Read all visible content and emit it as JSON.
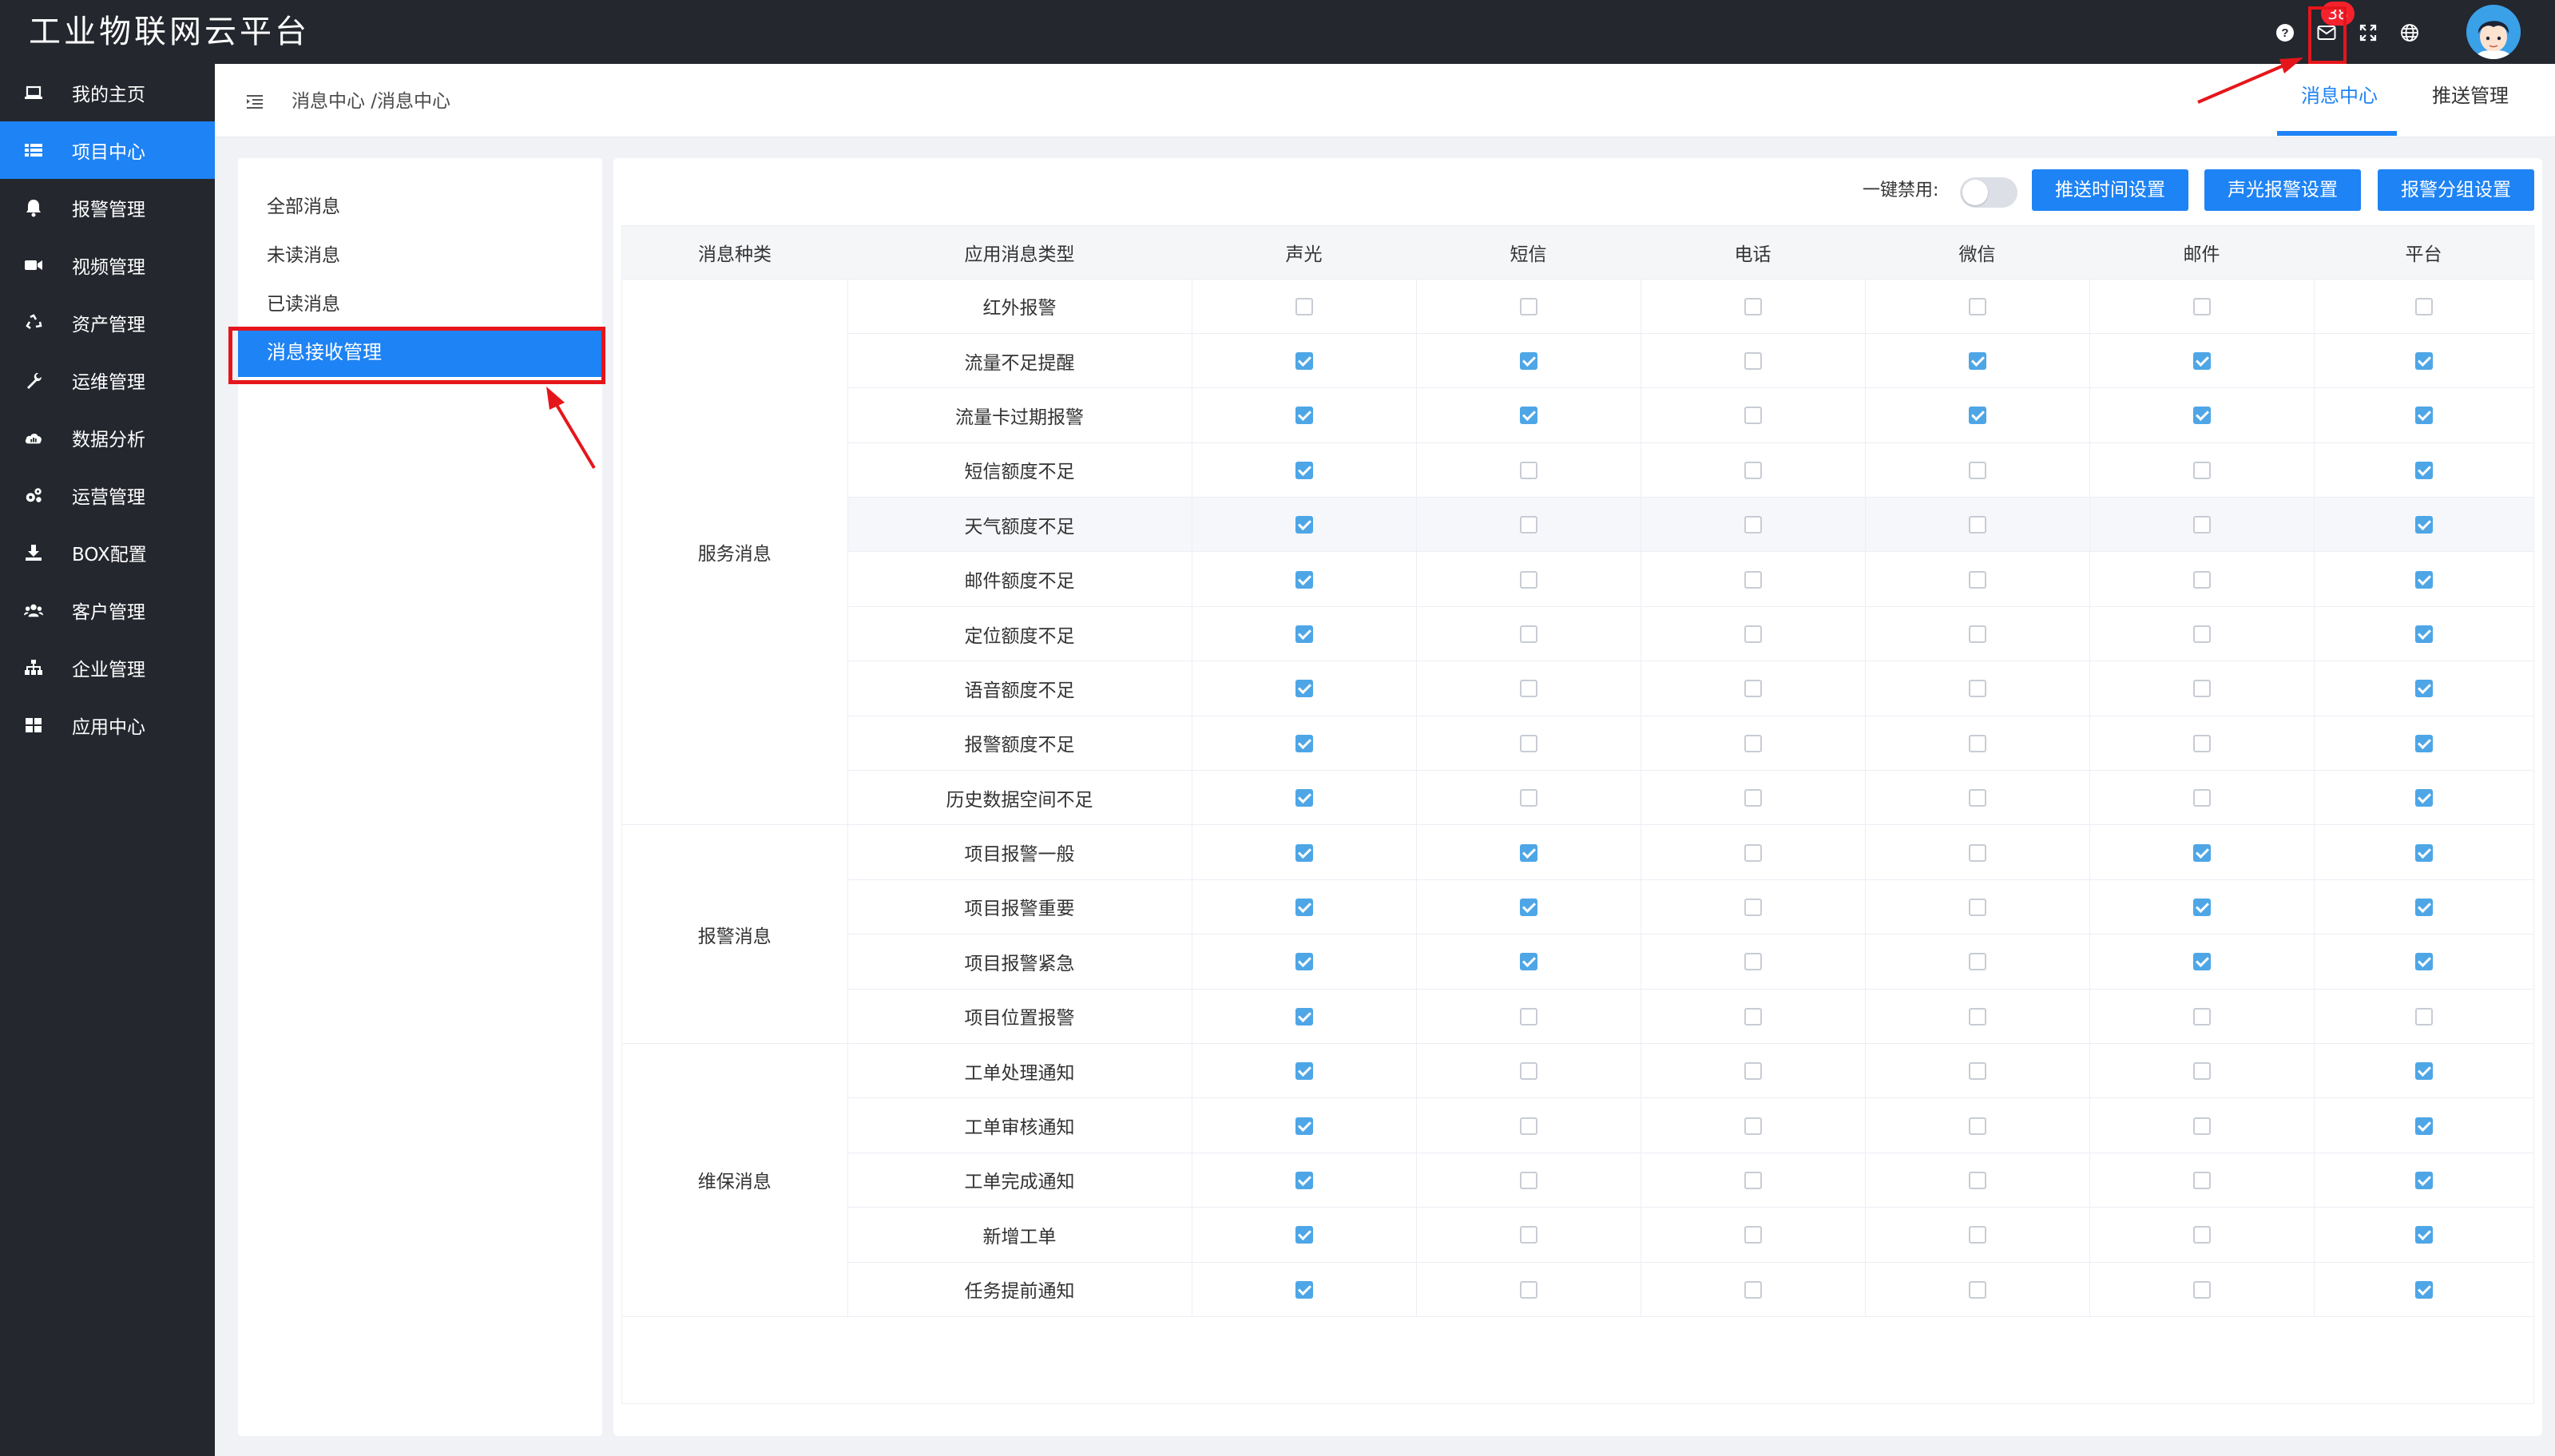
{
  "app": {
    "title": "工业物联网云平台"
  },
  "topbar": {
    "icons": [
      "question-circle-icon",
      "mail-icon",
      "fullscreen-icon",
      "globe-icon"
    ],
    "mail_badge": "38",
    "avatar": "user-avatar"
  },
  "sidebar": {
    "items": [
      {
        "label": "我的主页",
        "icon": "laptop-icon"
      },
      {
        "label": "项目中心",
        "icon": "list-icon",
        "active": true
      },
      {
        "label": "报警管理",
        "icon": "bell-icon"
      },
      {
        "label": "视频管理",
        "icon": "video-icon"
      },
      {
        "label": "资产管理",
        "icon": "recycle-icon"
      },
      {
        "label": "运维管理",
        "icon": "wrench-icon"
      },
      {
        "label": "数据分析",
        "icon": "cloud-chart-icon"
      },
      {
        "label": "运营管理",
        "icon": "gears-icon"
      },
      {
        "label": "BOX配置",
        "icon": "download-icon"
      },
      {
        "label": "客户管理",
        "icon": "users-icon"
      },
      {
        "label": "企业管理",
        "icon": "sitemap-icon"
      },
      {
        "label": "应用中心",
        "icon": "grid-icon"
      }
    ]
  },
  "header": {
    "breadcrumb": "消息中心 /消息中心",
    "tabs": [
      {
        "label": "消息中心",
        "active": true
      },
      {
        "label": "推送管理"
      }
    ]
  },
  "left_menu": {
    "items": [
      "全部消息",
      "未读消息",
      "已读消息",
      "消息接收管理"
    ],
    "active": "消息接收管理"
  },
  "toolbar": {
    "disable_all_label": "一键禁用:",
    "disable_all_on": false,
    "buttons": [
      "推送时间设置",
      "声光报警设置",
      "报警分组设置"
    ]
  },
  "table": {
    "columns": [
      "消息种类",
      "应用消息类型",
      "声光",
      "短信",
      "电话",
      "微信",
      "邮件",
      "平台"
    ],
    "groups": [
      {
        "category": "服务消息",
        "rows": [
          {
            "type": "红外报警",
            "checks": [
              false,
              false,
              false,
              false,
              false,
              false
            ]
          },
          {
            "type": "流量不足提醒",
            "checks": [
              true,
              true,
              false,
              true,
              true,
              true
            ]
          },
          {
            "type": "流量卡过期报警",
            "checks": [
              true,
              true,
              false,
              true,
              true,
              true
            ]
          },
          {
            "type": "短信额度不足",
            "checks": [
              true,
              false,
              false,
              false,
              false,
              true
            ]
          },
          {
            "type": "天气额度不足",
            "checks": [
              true,
              false,
              false,
              false,
              false,
              true
            ],
            "highlight": true
          },
          {
            "type": "邮件额度不足",
            "checks": [
              true,
              false,
              false,
              false,
              false,
              true
            ]
          },
          {
            "type": "定位额度不足",
            "checks": [
              true,
              false,
              false,
              false,
              false,
              true
            ]
          },
          {
            "type": "语音额度不足",
            "checks": [
              true,
              false,
              false,
              false,
              false,
              true
            ]
          },
          {
            "type": "报警额度不足",
            "checks": [
              true,
              false,
              false,
              false,
              false,
              true
            ]
          },
          {
            "type": "历史数据空间不足",
            "checks": [
              true,
              false,
              false,
              false,
              false,
              true
            ]
          }
        ]
      },
      {
        "category": "报警消息",
        "rows": [
          {
            "type": "项目报警一般",
            "checks": [
              true,
              true,
              false,
              false,
              true,
              true
            ]
          },
          {
            "type": "项目报警重要",
            "checks": [
              true,
              true,
              false,
              false,
              true,
              true
            ]
          },
          {
            "type": "项目报警紧急",
            "checks": [
              true,
              true,
              false,
              false,
              true,
              true
            ]
          },
          {
            "type": "项目位置报警",
            "checks": [
              true,
              false,
              false,
              false,
              false,
              false
            ]
          }
        ]
      },
      {
        "category": "维保消息",
        "rows": [
          {
            "type": "工单处理通知",
            "checks": [
              true,
              false,
              false,
              false,
              false,
              true
            ]
          },
          {
            "type": "工单审核通知",
            "checks": [
              true,
              false,
              false,
              false,
              false,
              true
            ]
          },
          {
            "type": "工单完成通知",
            "checks": [
              true,
              false,
              false,
              false,
              false,
              true
            ]
          },
          {
            "type": "新增工单",
            "checks": [
              true,
              false,
              false,
              false,
              false,
              true
            ]
          },
          {
            "type": "任务提前通知",
            "checks": [
              true,
              false,
              false,
              false,
              false,
              true
            ]
          }
        ]
      }
    ]
  },
  "colors": {
    "primary": "#1e83f4",
    "topbar_bg": "#24272e",
    "sidebar_bg": "#24272e",
    "checkbox_checked": "#4ea6e6",
    "annotation_red": "#e5161b",
    "badge_red": "#f5222d"
  }
}
